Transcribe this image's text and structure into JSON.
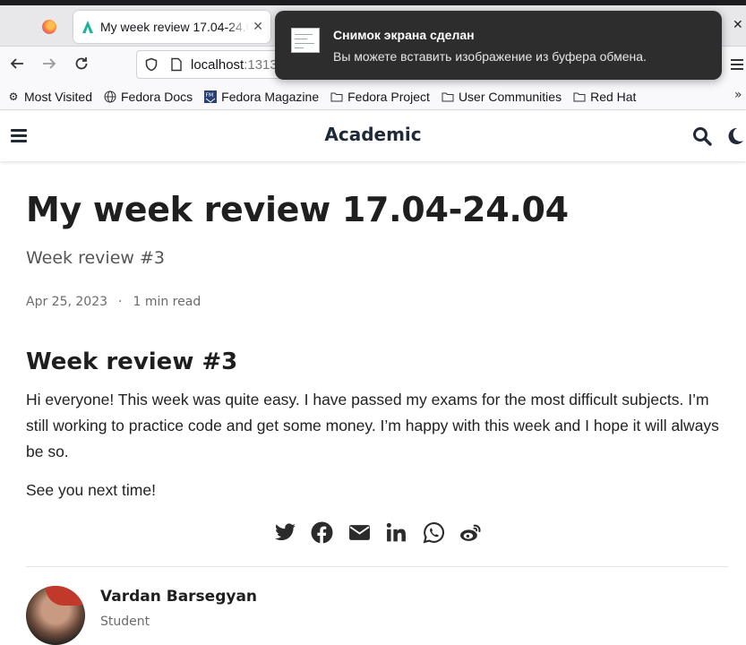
{
  "browser": {
    "tab_title": "My week review 17.04-24.04 | Academic",
    "url_host": "localhost",
    "url_port": ":1313",
    "bookmarks": [
      {
        "label": "Most Visited",
        "icon": "gear-icon"
      },
      {
        "label": "Fedora Docs",
        "icon": "globe-icon"
      },
      {
        "label": "Fedora Magazine",
        "icon": "fm-icon"
      },
      {
        "label": "Fedora Project",
        "icon": "folder-icon"
      },
      {
        "label": "User Communities",
        "icon": "folder-icon"
      },
      {
        "label": "Red Hat",
        "icon": "folder-icon"
      }
    ]
  },
  "notification": {
    "title": "Снимок экрана сделан",
    "body": "Вы можете вставить изображение из буфера обмена."
  },
  "site": {
    "brand": "Academic"
  },
  "article": {
    "title": "My week review 17.04-24.04",
    "subtitle": "Week review #3",
    "date": "Apr 25, 2023",
    "separator": "·",
    "read_time": "1 min read",
    "heading": "Week review #3",
    "paragraph": "Hi everyone! This week was quite easy. I have passed my exams for the most difficult subjects. I’m still working to practice code and get some money. I’m happy with this week and I hope it will always be so.",
    "closing": "See you next time!"
  },
  "share_icons": [
    "twitter-icon",
    "facebook-icon",
    "email-icon",
    "linkedin-icon",
    "whatsapp-icon",
    "weibo-icon"
  ],
  "author": {
    "name": "Vardan Barsegyan",
    "role": "Student"
  }
}
